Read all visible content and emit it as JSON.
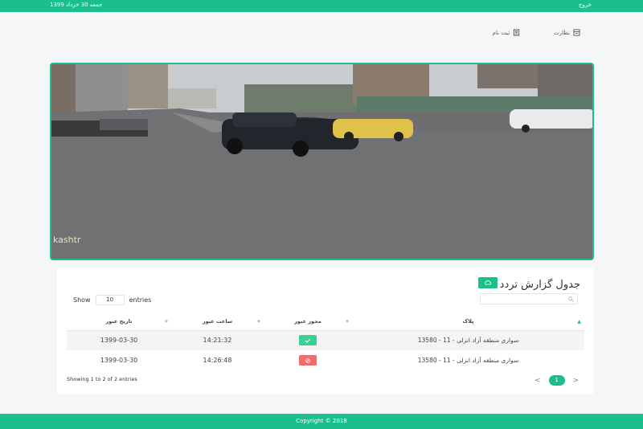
{
  "topbar": {
    "date": "جمعه 30 خرداد 1399",
    "logout": "خروج"
  },
  "nav": {
    "items": [
      {
        "label": "نظارت",
        "icon": "monitor-icon"
      },
      {
        "label": "ثبت نام",
        "icon": "register-icon"
      }
    ]
  },
  "video": {
    "watermark": "kashtr"
  },
  "report": {
    "title": "جدول گزارش تردد",
    "show_label": "Show",
    "entries_label": "entries",
    "page_length": "10",
    "search_value": "",
    "columns": [
      "پلاک",
      "مجوز عبور",
      "ساعت عبور",
      "تاریخ عبور"
    ],
    "rows": [
      {
        "plate": "سواری منطقه آزاد انزلی - 11 - 13580",
        "permit": "allowed",
        "time": "14:21:32",
        "date": "1399-03-30"
      },
      {
        "plate": "سواری منطقه آزاد انزلی - 11 - 13580",
        "permit": "denied",
        "time": "14:26:48",
        "date": "1399-03-30"
      }
    ],
    "info": "Showing 1 to 2 of 2 entries",
    "pager": {
      "prev": "<",
      "current": "1",
      "next": ">"
    }
  },
  "footer": {
    "text": "Copyright © 2018"
  },
  "colors": {
    "accent": "#1bbf8e",
    "allowed": "#3bcf94",
    "denied": "#f06d6d"
  }
}
